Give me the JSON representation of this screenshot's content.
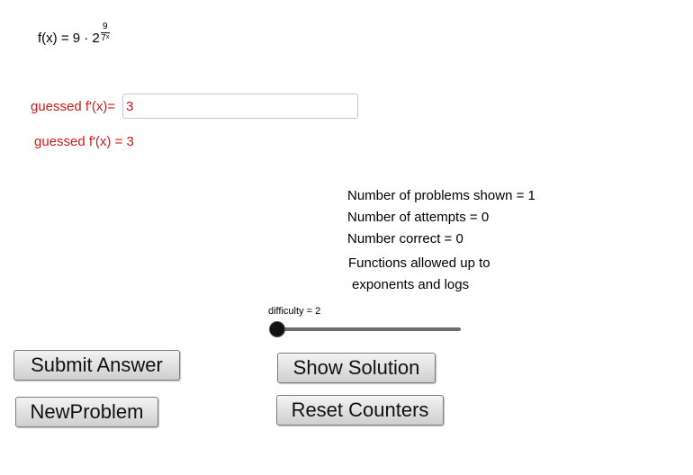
{
  "function": {
    "lhs": "f(x) = 9 · 2",
    "exp_numerator": "9",
    "exp_den_base": "7",
    "exp_den_power": "x"
  },
  "guess": {
    "label": "guessed f'(x)=",
    "value": "3",
    "echo": "guessed f'(x) = 3"
  },
  "stats": {
    "problems_shown": "Number of problems shown = 1",
    "attempts": "Number of attempts = 0",
    "correct": "Number correct = 0",
    "functions_allowed_line1": "Functions allowed up to",
    "functions_allowed_line2": "exponents and logs"
  },
  "difficulty": {
    "label": "difficulty = 2",
    "value": 2
  },
  "buttons": {
    "submit": "Submit Answer",
    "new_problem": "NewProblem",
    "show_solution": "Show Solution",
    "reset_counters": "Reset Counters"
  },
  "colors": {
    "guess_text": "#d11a1a"
  }
}
